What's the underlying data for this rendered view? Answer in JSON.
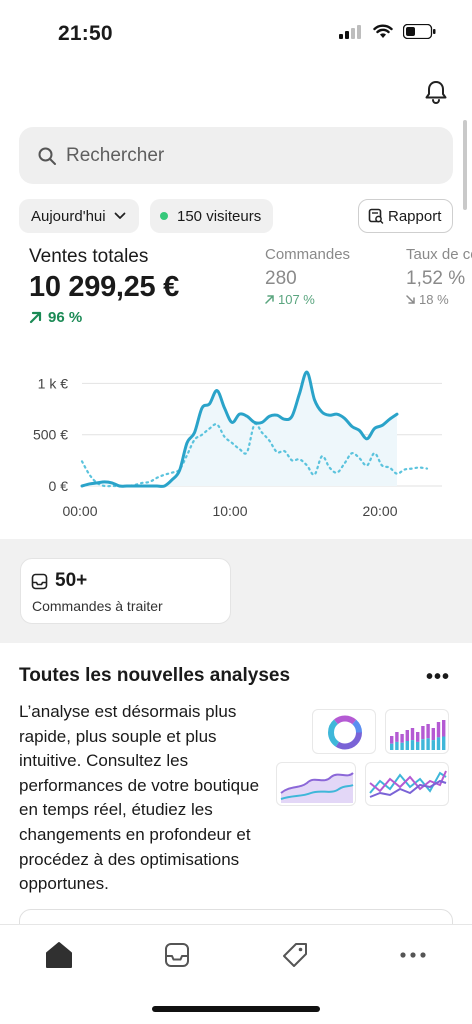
{
  "status_bar": {
    "time": "21:50"
  },
  "search": {
    "placeholder": "Rechercher"
  },
  "filters": {
    "period_label": "Aujourd'hui",
    "visitors_label": "150 visiteurs",
    "report_label": "Rapport"
  },
  "kpis": {
    "total_sales": {
      "label": "Ventes totales",
      "value": "10 299,25 €",
      "change": "96 %"
    },
    "orders": {
      "label": "Commandes",
      "value": "280",
      "change": "107 %"
    },
    "conversion": {
      "label": "Taux de conversion",
      "value": "1,52 %",
      "change": "18 %"
    }
  },
  "chart_data": {
    "type": "line",
    "title": "",
    "xlabel": "",
    "ylabel": "",
    "x_ticks": [
      "00:00",
      "10:00",
      "20:00"
    ],
    "y_ticks": [
      "0 €",
      "500 €",
      "1 k €"
    ],
    "ylim": [
      0,
      1150
    ],
    "xlim": [
      0,
      24
    ],
    "grid": true,
    "series": [
      {
        "style": "solid",
        "color": "#2aa3c9",
        "x": [
          0,
          0.5,
          1,
          1.5,
          2,
          2.5,
          3,
          3.5,
          4,
          4.5,
          5,
          5.5,
          6,
          6.5,
          7,
          7.5,
          8,
          8.5,
          9,
          9.5,
          10,
          10.5,
          11,
          11.5,
          12,
          12.5,
          13,
          13.5,
          14,
          14.5,
          15,
          15.5,
          16,
          16.5,
          17,
          17.5,
          18,
          18.5,
          19,
          19.5,
          20,
          20.5,
          21
        ],
        "y": [
          0,
          20,
          30,
          40,
          30,
          0,
          0,
          0,
          0,
          0,
          0,
          0,
          60,
          150,
          420,
          520,
          760,
          800,
          930,
          760,
          620,
          700,
          680,
          620,
          620,
          680,
          690,
          650,
          680,
          900,
          1110,
          840,
          720,
          690,
          700,
          660,
          580,
          540,
          460,
          560,
          590,
          650,
          700
        ]
      },
      {
        "style": "dotted",
        "color": "#5bc3dd",
        "x": [
          0,
          0.5,
          1,
          1.5,
          2,
          2.5,
          3,
          3.5,
          4,
          4.5,
          5,
          5.5,
          6,
          6.5,
          7,
          7.5,
          8,
          8.5,
          9,
          9.5,
          10,
          10.5,
          11,
          11.5,
          12,
          12.5,
          13,
          13.5,
          14,
          14.5,
          15,
          15.5,
          16,
          16.5,
          17,
          17.5,
          18,
          18.5,
          19,
          19.5,
          20,
          20.5,
          21,
          21.5,
          22,
          22.5,
          23
        ],
        "y": [
          240,
          110,
          30,
          0,
          0,
          0,
          0,
          10,
          30,
          40,
          80,
          110,
          130,
          160,
          300,
          450,
          500,
          560,
          600,
          480,
          420,
          360,
          330,
          600,
          520,
          440,
          330,
          340,
          250,
          260,
          200,
          110,
          290,
          180,
          130,
          220,
          320,
          270,
          200,
          320,
          200,
          180,
          120,
          160,
          170,
          180,
          170
        ]
      }
    ]
  },
  "orders_to_process": {
    "count": "50+",
    "label": "Commandes à traiter"
  },
  "analytics_card": {
    "title": "Toutes les nouvelles analyses",
    "body": "L’analyse est désormais plus rapide, plus souple et plus intuitive. Consultez les performances de votre boutique en temps réel, étudiez les changements en profondeur et procédez à des optimisations opportunes."
  },
  "icons": {
    "bell": "bell-icon",
    "search": "search-icon",
    "report": "report-icon",
    "inbox": "inbox-icon",
    "home": "home-icon",
    "orders": "orders-icon",
    "tag": "tag-icon",
    "more": "more-icon"
  }
}
